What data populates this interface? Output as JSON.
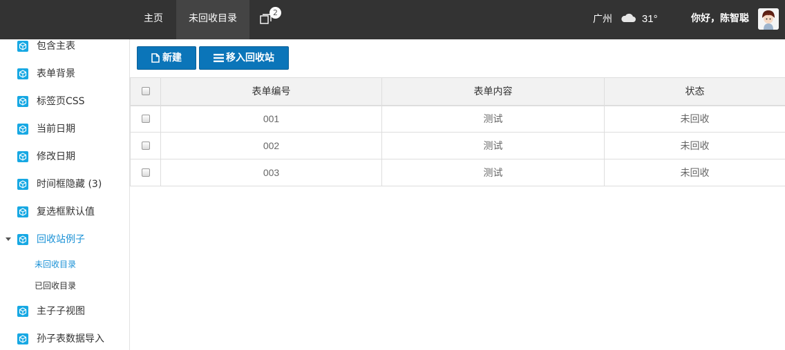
{
  "header": {
    "nav": {
      "home": "主页",
      "active": "未回收目录",
      "tabs_badge": "2"
    },
    "weather": {
      "city": "广州",
      "icon": "cloud-icon",
      "temperature": "31°"
    },
    "greeting": "你好，陈智聪",
    "colors": {
      "bar": "#333333",
      "active_tab": "#444444"
    }
  },
  "sidebar": {
    "items": [
      {
        "label": "包含主表",
        "icon": "cube-icon"
      },
      {
        "label": "表单背景",
        "icon": "cube-icon"
      },
      {
        "label": "标签页CSS",
        "icon": "cube-icon"
      },
      {
        "label": "当前日期",
        "icon": "cube-icon"
      },
      {
        "label": "修改日期",
        "icon": "cube-icon"
      },
      {
        "label": "时间框隐藏 (3)",
        "icon": "cube-icon"
      },
      {
        "label": "复选框默认值",
        "icon": "cube-icon"
      },
      {
        "label": "回收站例子",
        "icon": "cube-icon",
        "expanded": true,
        "active": true
      },
      {
        "label": "主子子视图",
        "icon": "cube-icon"
      },
      {
        "label": "孙子表数据导入",
        "icon": "cube-icon"
      }
    ],
    "sub_items": [
      {
        "label": "未回收目录",
        "active": true
      },
      {
        "label": "已回收目录",
        "active": false
      }
    ],
    "colors": {
      "accent": "#1a91d6",
      "icon": "#17a8e3"
    }
  },
  "toolbar": {
    "new_label": "新建",
    "recycle_label": "移入回收站",
    "colors": {
      "button": "#0b75b9"
    }
  },
  "table": {
    "columns": [
      "表单编号",
      "表单内容",
      "状态"
    ],
    "rows": [
      {
        "code": "001",
        "content": "测试",
        "status": "未回收"
      },
      {
        "code": "002",
        "content": "测试",
        "status": "未回收"
      },
      {
        "code": "003",
        "content": "测试",
        "status": "未回收"
      }
    ]
  }
}
